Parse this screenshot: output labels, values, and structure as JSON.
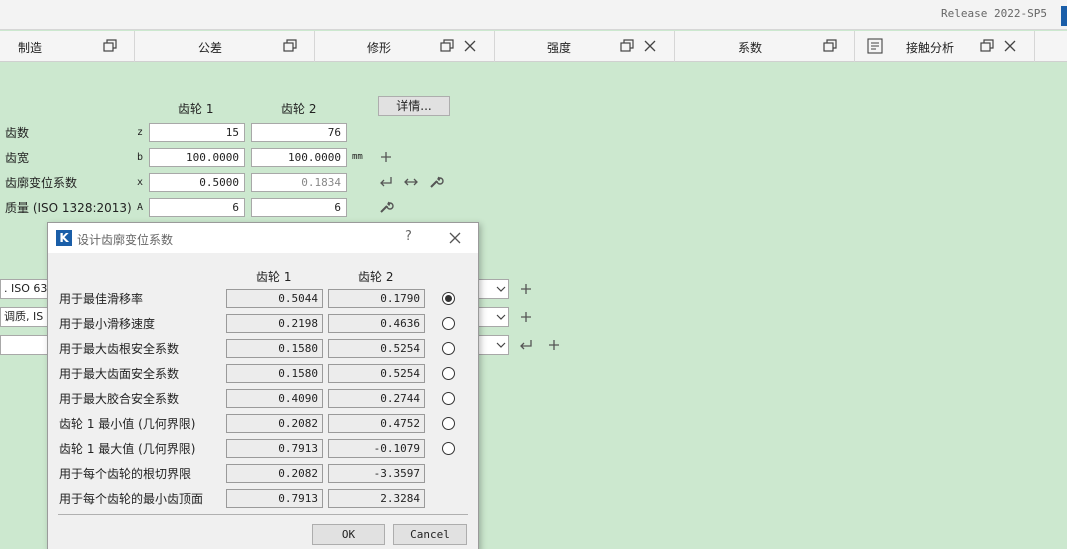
{
  "app": {
    "release": "Release 2022-SP5"
  },
  "tabs": [
    {
      "label": "制造"
    },
    {
      "label": "公差"
    },
    {
      "label": "修形"
    },
    {
      "label": "强度"
    },
    {
      "label": "系数"
    },
    {
      "label": "接触分析"
    }
  ],
  "main": {
    "col_gear1": "齿轮 1",
    "col_gear2": "齿轮 2",
    "details_button": "详情...",
    "rows": [
      {
        "label": "齿数",
        "symbol": "z",
        "g1": "15",
        "g2": "76",
        "unit": ""
      },
      {
        "label": "齿宽",
        "symbol": "b",
        "g1": "100.0000",
        "g2": "100.0000",
        "unit": "mm"
      },
      {
        "label": "齿廓变位系数",
        "symbol": "x",
        "g1": "0.5000",
        "g2": "0.1834",
        "unit": ""
      },
      {
        "label": "质量 (ISO 1328:2013)",
        "symbol": "A",
        "g1": "6",
        "g2": "6",
        "unit": ""
      }
    ],
    "combos": [
      {
        "value": ". ISO 63"
      },
      {
        "value": "调质, IS"
      },
      {
        "value": ""
      }
    ]
  },
  "dialog": {
    "title": "设计齿廓变位系数",
    "help": "?",
    "col_gear1": "齿轮 1",
    "col_gear2": "齿轮 2",
    "rows": [
      {
        "label": "用于最佳滑移率",
        "g1": "0.5044",
        "g2": "0.1790",
        "radio": true,
        "selected": true
      },
      {
        "label": "用于最小滑移速度",
        "g1": "0.2198",
        "g2": "0.4636",
        "radio": true,
        "selected": false
      },
      {
        "label": "用于最大齿根安全系数",
        "g1": "0.1580",
        "g2": "0.5254",
        "radio": true,
        "selected": false
      },
      {
        "label": "用于最大齿面安全系数",
        "g1": "0.1580",
        "g2": "0.5254",
        "radio": true,
        "selected": false
      },
      {
        "label": "用于最大胶合安全系数",
        "g1": "0.4090",
        "g2": "0.2744",
        "radio": true,
        "selected": false
      },
      {
        "label": "齿轮 1 最小值 (几何界限)",
        "g1": "0.2082",
        "g2": "0.4752",
        "radio": true,
        "selected": false
      },
      {
        "label": "齿轮 1 最大值 (几何界限)",
        "g1": "0.7913",
        "g2": "-0.1079",
        "radio": true,
        "selected": false
      },
      {
        "label": "用于每个齿轮的根切界限",
        "g1": "0.2082",
        "g2": "-3.3597",
        "radio": false,
        "selected": false
      },
      {
        "label": "用于每个齿轮的最小齿顶面",
        "g1": "0.7913",
        "g2": "2.3284",
        "radio": false,
        "selected": false
      }
    ],
    "ok_label": "OK",
    "cancel_label": "Cancel"
  }
}
